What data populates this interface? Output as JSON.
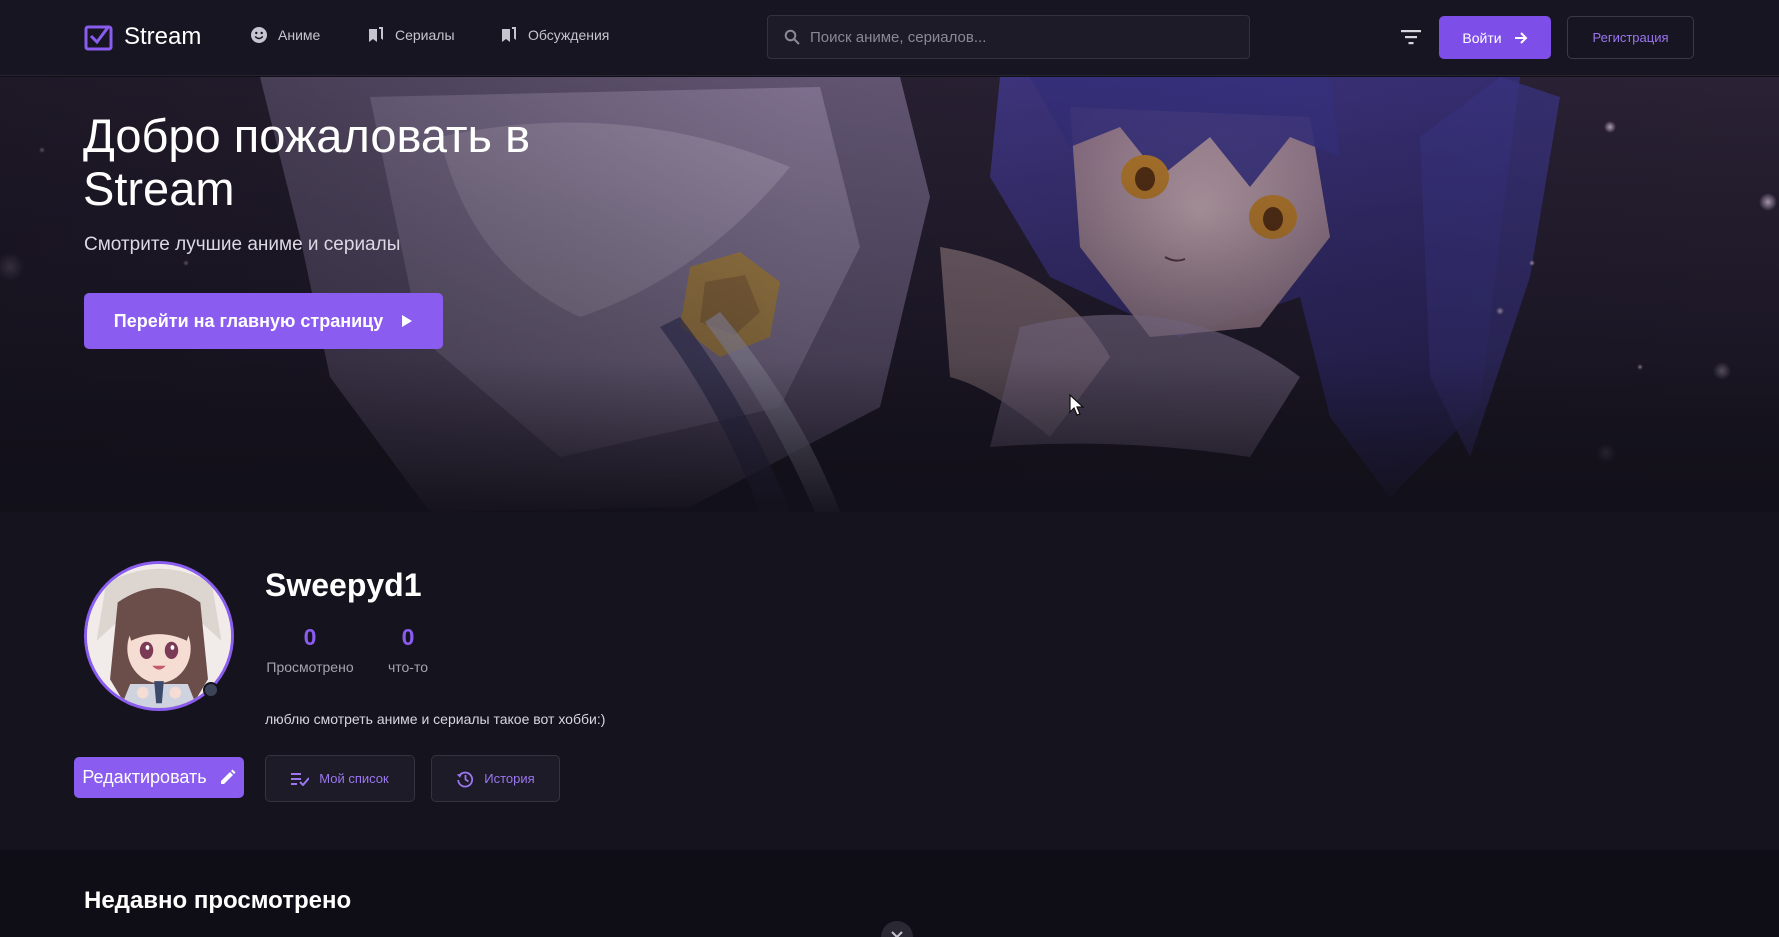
{
  "header": {
    "logo_text": "Stream",
    "nav": [
      {
        "label": "Аниме",
        "icon": "smile-icon"
      },
      {
        "label": "Сериалы",
        "icon": "bookmarks-icon"
      },
      {
        "label": "Обсуждения",
        "icon": "bookmarks-icon"
      }
    ],
    "search_placeholder": "Поиск аниме, сериалов...",
    "login_label": "Войти",
    "register_label": "Регистрация"
  },
  "hero": {
    "title": "Добро пожаловать в Stream",
    "subtitle": "Смотрите лучшие аниме и сериалы",
    "cta_label": "Перейти на главную страницу"
  },
  "profile": {
    "username": "Sweepyd1",
    "stats": [
      {
        "value": "0",
        "label": "Просмотрено"
      },
      {
        "value": "0",
        "label": "что-то"
      }
    ],
    "bio": "люблю смотреть аниме и сериалы такое вот хобби:)",
    "edit_label": "Редактировать",
    "my_list_label": "Мой список",
    "history_label": "История"
  },
  "recent": {
    "title": "Недавно просмотрено"
  },
  "colors": {
    "accent": "#8a5cf0",
    "accent_text": "#9b76ef",
    "background": "#0f0e16",
    "navbar": "#161521"
  }
}
